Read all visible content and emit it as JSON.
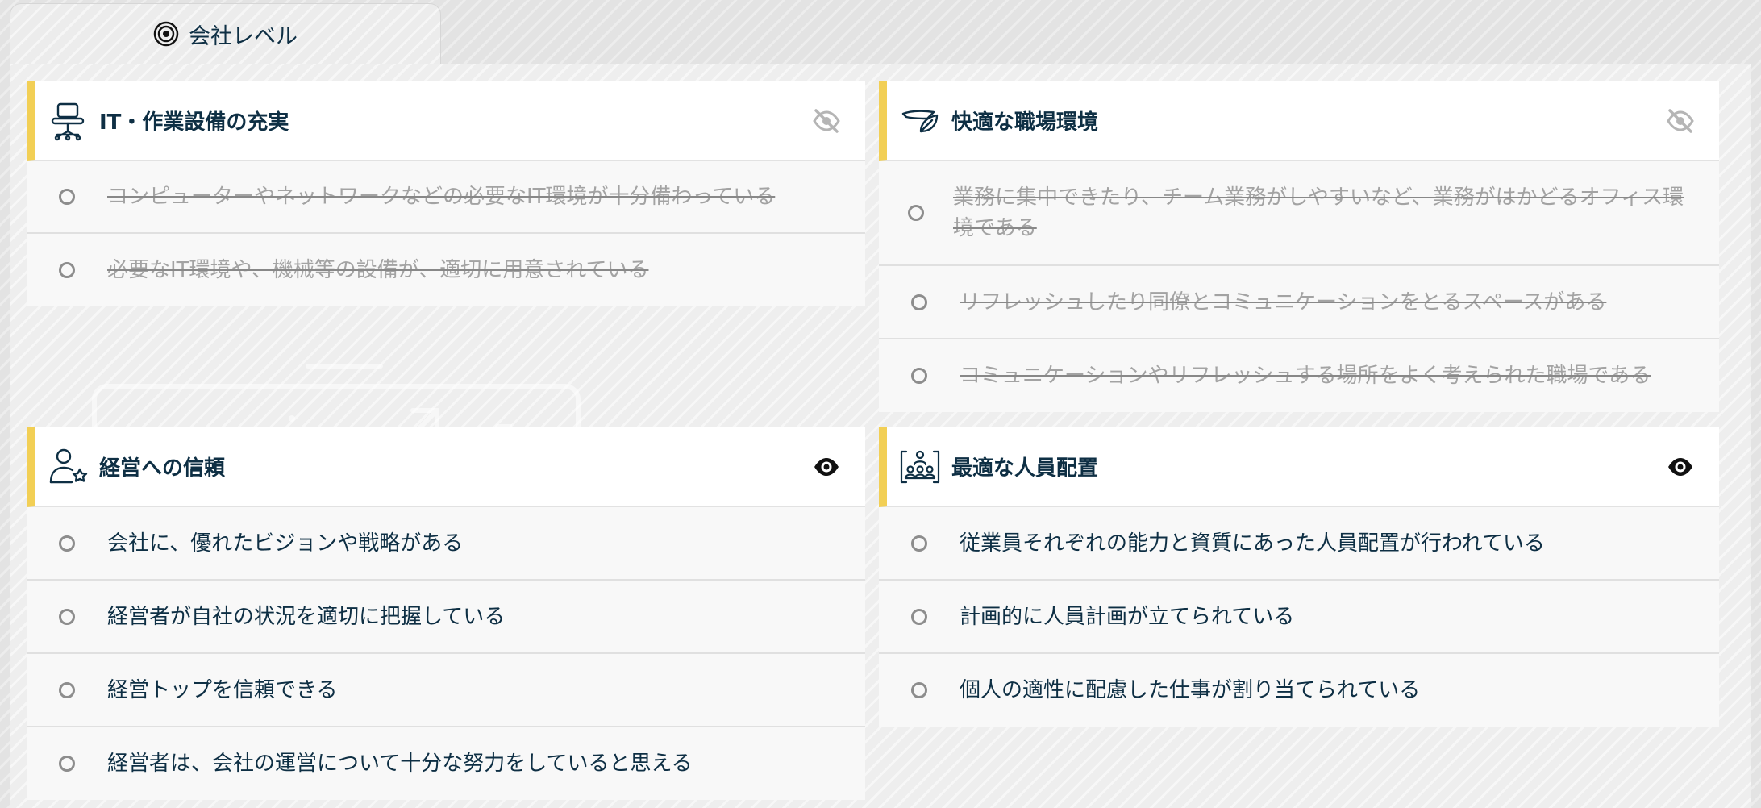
{
  "tab": {
    "label": "会社レベル",
    "icon": "target-icon"
  },
  "colors": {
    "accent": "#f2cf55",
    "text": "#0e2f44",
    "muted": "#a3a3a3"
  },
  "cards": [
    {
      "title": "IT・作業設備の充実",
      "icon": "office-chair-icon",
      "visibility": "hidden",
      "items": [
        "コンピューターやネットワークなどの必要なIT環境が十分備わっている",
        "必要なIT環境や、機械等の設備が、適切に用意されている"
      ]
    },
    {
      "title": "快適な職場環境",
      "icon": "leaf-hand-icon",
      "visibility": "hidden",
      "items": [
        "業務に集中できたり、チーム業務がしやすいなど、業務がはかどるオフィス環境である",
        "リフレッシュしたり同僚とコミュニケーションをとるスペースがある",
        "コミュニケーションやリフレッシュする場所をよく考えられた職場である"
      ]
    },
    {
      "title": "経営への信頼",
      "icon": "user-star-icon",
      "visibility": "visible",
      "items": [
        "会社に、優れたビジョンや戦略がある",
        "経営者が自社の状況を適切に把握している",
        "経営トップを信頼できる",
        "経営者は、会社の運営について十分な努力をしていると思える"
      ]
    },
    {
      "title": "最適な人員配置",
      "icon": "team-structure-icon",
      "visibility": "visible",
      "items": [
        "従業員それぞれの能力と資質にあった人員配置が行われている",
        "計画的に人員計画が立てられている",
        "個人の適性に配慮した仕事が割り当てられている"
      ]
    }
  ]
}
